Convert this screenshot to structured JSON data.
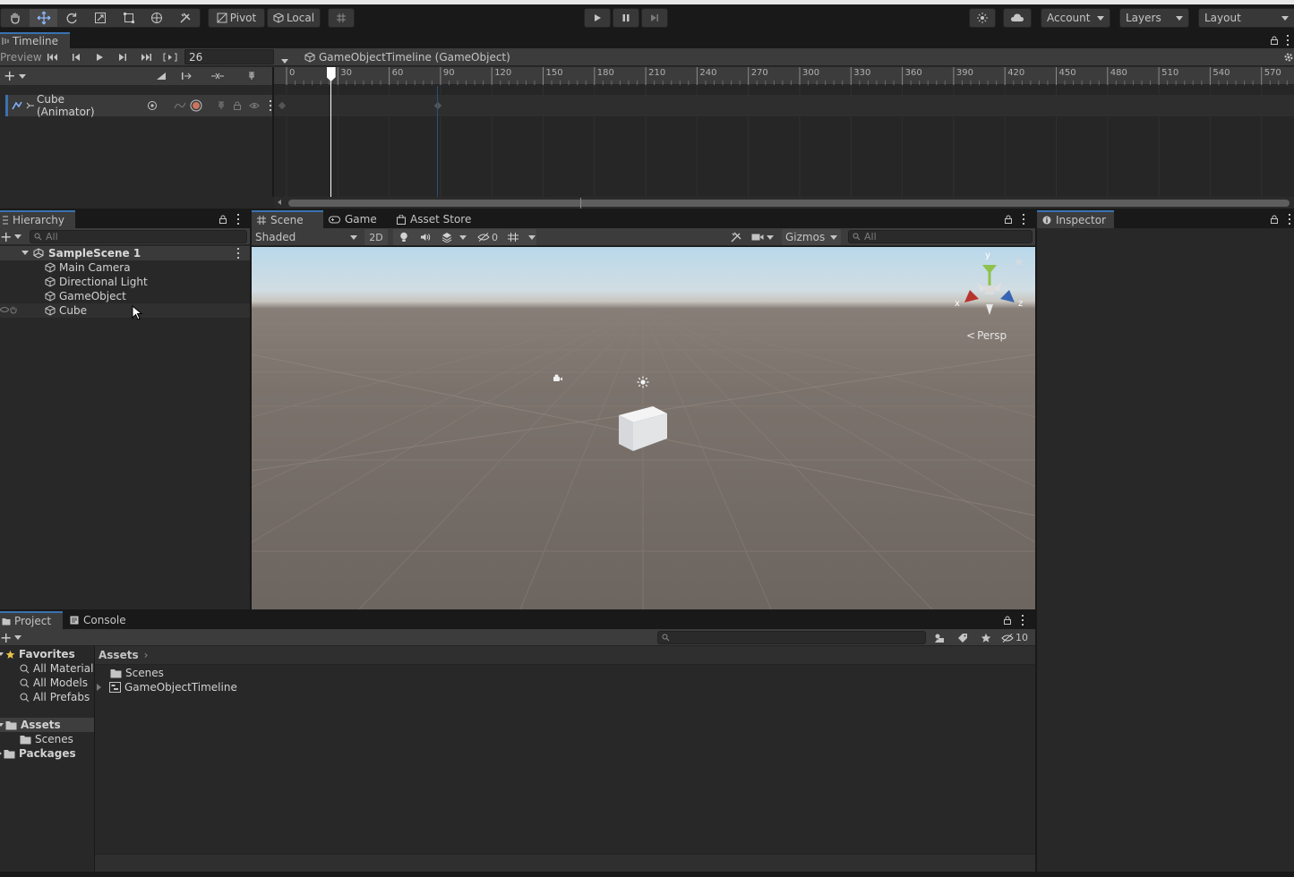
{
  "colors": {
    "bg_dark": "#191919",
    "panel": "#282828",
    "toolbar": "#3c3c3c",
    "accent_blue": "#3a72b0",
    "playhead": "#ffffff"
  },
  "main_toolbar": {
    "pivot_label": "Pivot",
    "local_label": "Local",
    "account_label": "Account",
    "layers_label": "Layers",
    "layout_label": "Layout"
  },
  "timeline": {
    "tab_label": "Timeline",
    "preview_label": "Preview",
    "frame_value": "26",
    "asset_label": "GameObjectTimeline (GameObject)",
    "ruler_ticks": [
      "0",
      "30",
      "60",
      "90",
      "120",
      "150",
      "180",
      "210",
      "240",
      "270",
      "300",
      "330",
      "360",
      "390",
      "420",
      "450",
      "480",
      "510",
      "540",
      "570"
    ],
    "playhead_frame": 26,
    "track_label": "Cube (Animator)"
  },
  "hierarchy": {
    "tab_label": "Hierarchy",
    "search_placeholder": "All",
    "scene_name": "SampleScene 1",
    "items": [
      "Main Camera",
      "Directional Light",
      "GameObject",
      "Cube"
    ]
  },
  "scene_view": {
    "tabs": [
      "Scene",
      "Game",
      "Asset Store"
    ],
    "shading_mode": "Shaded",
    "mode_2d": "2D",
    "hidden_count": "0",
    "gizmos_label": "Gizmos",
    "search_placeholder": "All",
    "axis_y": "y",
    "axis_x": "x",
    "axis_z": "z",
    "projection_label": "Persp"
  },
  "inspector": {
    "tab_label": "Inspector"
  },
  "project": {
    "tabs": [
      "Project",
      "Console"
    ],
    "hidden_count": "10",
    "favorites_label": "Favorites",
    "favorites": [
      "All Materials",
      "All Models",
      "All Prefabs"
    ],
    "assets_label": "Assets",
    "assets_children": [
      "Scenes"
    ],
    "packages_label": "Packages",
    "breadcrumb": "Assets",
    "grid_items": [
      "Scenes",
      "GameObjectTimeline"
    ]
  }
}
